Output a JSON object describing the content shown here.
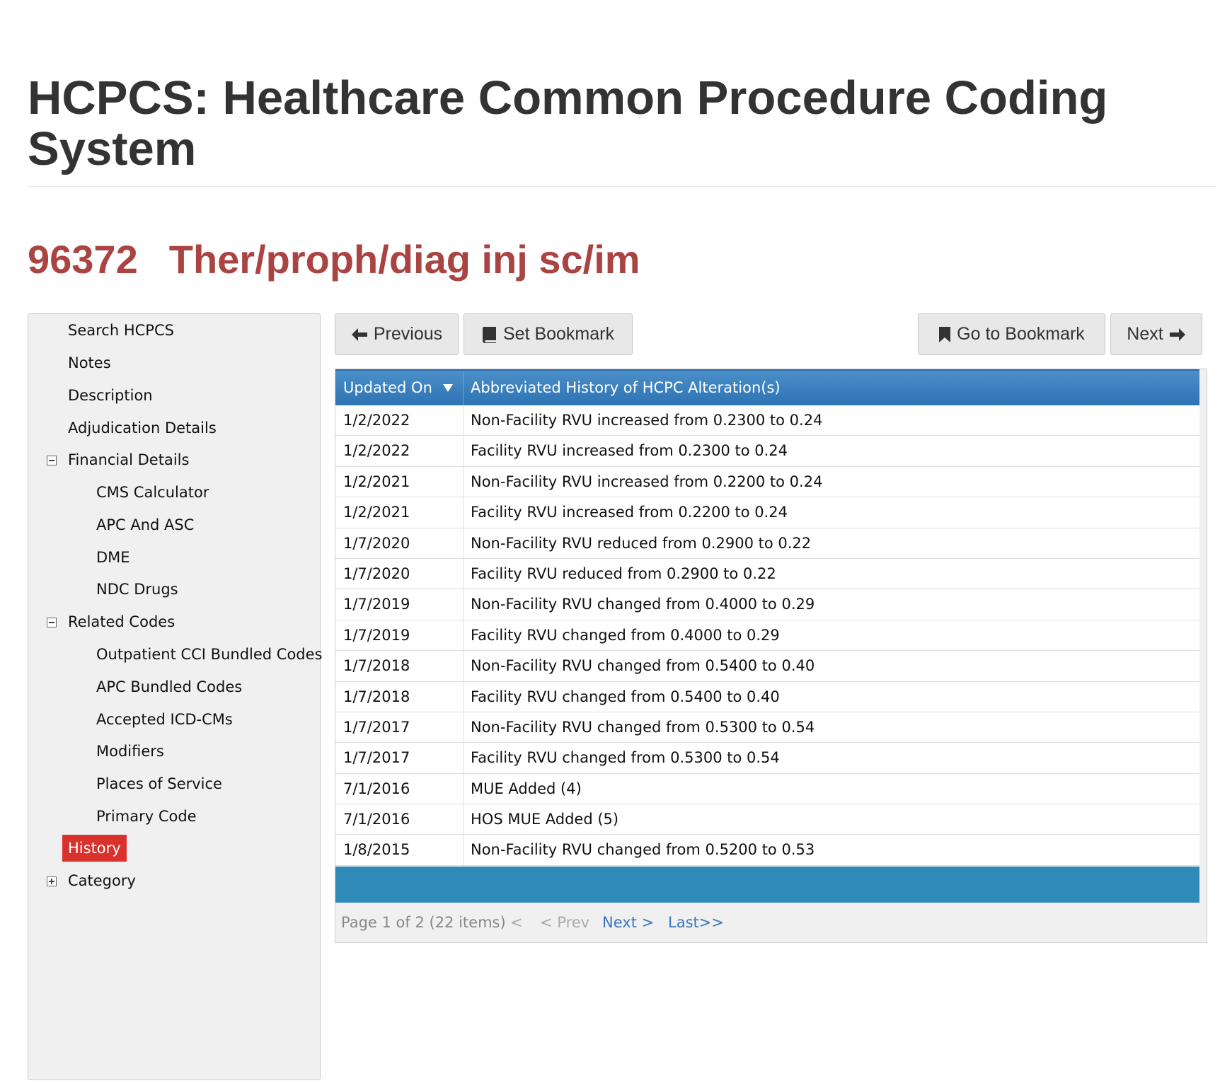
{
  "header": {
    "title": "HCPCS: Healthcare Common Procedure Coding System",
    "code": "96372",
    "code_description": "Ther/proph/diag inj sc/im"
  },
  "sidebar": {
    "items": [
      {
        "label": "Search HCPCS"
      },
      {
        "label": "Notes"
      },
      {
        "label": "Description"
      },
      {
        "label": "Adjudication Details"
      },
      {
        "label": "Financial Details",
        "expanded": true
      },
      {
        "label": "CMS Calculator"
      },
      {
        "label": "APC And ASC"
      },
      {
        "label": "DME"
      },
      {
        "label": "NDC Drugs"
      },
      {
        "label": "Related Codes",
        "expanded": true
      },
      {
        "label": "Outpatient CCI Bundled Codes"
      },
      {
        "label": "APC Bundled Codes"
      },
      {
        "label": "Accepted ICD-CMs"
      },
      {
        "label": "Modifiers"
      },
      {
        "label": "Places of Service"
      },
      {
        "label": "Primary Code"
      },
      {
        "label": "History",
        "active": true
      },
      {
        "label": "Category",
        "expanded": false
      }
    ]
  },
  "toolbar": {
    "previous_label": "Previous",
    "set_bookmark_label": "Set Bookmark",
    "go_to_bookmark_label": "Go to Bookmark",
    "next_label": "Next"
  },
  "table": {
    "columns": [
      "Updated On",
      "Abbreviated History of HCPC Alteration(s)"
    ],
    "rows": [
      {
        "date": "1/2/2022",
        "change": "Non-Facility RVU increased from 0.2300 to 0.24"
      },
      {
        "date": "1/2/2022",
        "change": "Facility RVU increased from 0.2300 to 0.24"
      },
      {
        "date": "1/2/2021",
        "change": "Non-Facility RVU increased from 0.2200 to 0.24"
      },
      {
        "date": "1/2/2021",
        "change": "Facility RVU increased from 0.2200 to 0.24"
      },
      {
        "date": "1/7/2020",
        "change": "Non-Facility RVU reduced from 0.2900 to 0.22"
      },
      {
        "date": "1/7/2020",
        "change": "Facility RVU reduced from 0.2900 to 0.22"
      },
      {
        "date": "1/7/2019",
        "change": "Non-Facility RVU changed from 0.4000 to 0.29"
      },
      {
        "date": "1/7/2019",
        "change": "Facility RVU changed from 0.4000 to 0.29"
      },
      {
        "date": "1/7/2018",
        "change": "Non-Facility RVU changed from 0.5400 to 0.40"
      },
      {
        "date": "1/7/2018",
        "change": "Facility RVU changed from 0.5400 to 0.40"
      },
      {
        "date": "1/7/2017",
        "change": "Non-Facility RVU changed from 0.5300 to 0.54"
      },
      {
        "date": "1/7/2017",
        "change": "Facility RVU changed from 0.5300 to 0.54"
      },
      {
        "date": "7/1/2016",
        "change": "MUE Added (4)"
      },
      {
        "date": "7/1/2016",
        "change": "HOS MUE Added (5)"
      },
      {
        "date": "1/8/2015",
        "change": "Non-Facility RVU changed from 0.5200 to 0.53"
      }
    ]
  },
  "pager": {
    "info": "Page 1 of 2 (22 items)",
    "first": "<",
    "prev": "< Prev",
    "next": "Next >",
    "last": "Last>>"
  },
  "colors": {
    "heading_red": "#a94442",
    "active_item": "#d9322d",
    "table_header": "#2e73b3",
    "table_footer": "#2e8bb8",
    "link_blue": "#3a75c4"
  }
}
